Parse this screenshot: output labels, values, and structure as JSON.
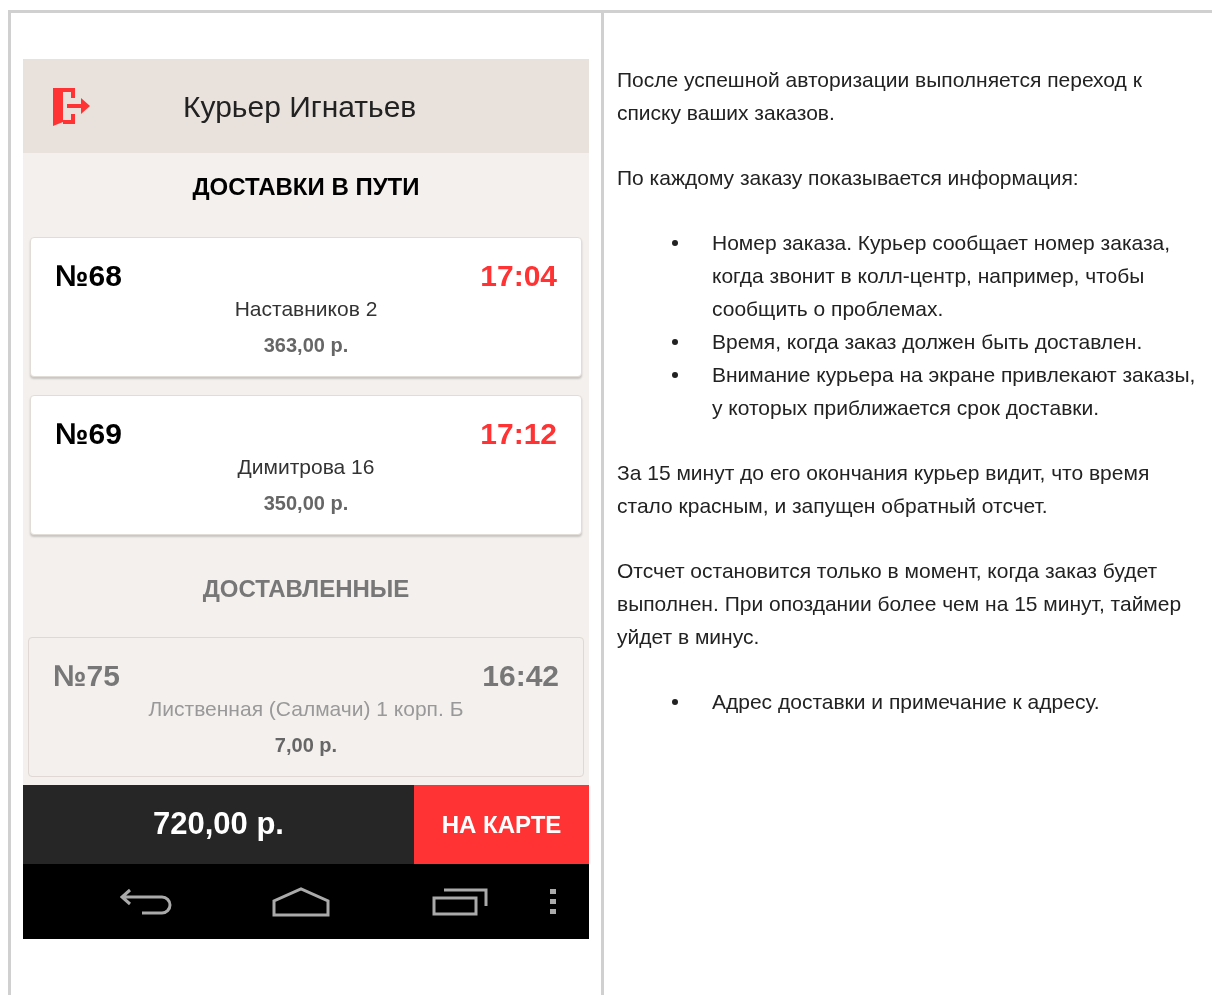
{
  "phone": {
    "header": {
      "title": "Курьер Игнатьев"
    },
    "sections": [
      {
        "kind": "active",
        "title": "ДОСТАВКИ В ПУТИ",
        "orders": [
          {
            "number": "№68",
            "time": "17:04",
            "urgent": true,
            "address": "Наставников 2",
            "price": "363,00 р."
          },
          {
            "number": "№69",
            "time": "17:12",
            "urgent": true,
            "address": "Димитрова 16",
            "price": "350,00 р."
          }
        ]
      },
      {
        "kind": "delivered",
        "title": "ДОСТАВЛЕННЫЕ",
        "orders": [
          {
            "number": "№75",
            "time": "16:42",
            "urgent": false,
            "address": "Лиственная (Салмачи) 1 корп. Б",
            "price": "7,00 р."
          }
        ]
      }
    ],
    "bottom_bar": {
      "total": "720,00 р.",
      "map_button": "НА КАРТЕ"
    }
  },
  "description": [
    {
      "kind": "paragraph",
      "text": "После успешной авторизации выполняется переход к списку ваших заказов."
    },
    {
      "kind": "paragraph",
      "text": "По каждому заказу показывается информация:"
    },
    {
      "kind": "list",
      "items": [
        "Номер заказа. Курьер сообщает номер заказа, когда звонит в колл-центр, например, чтобы сообщить о проблемах.",
        "Время, когда заказ должен быть доставлен.",
        "Внимание курьера на экране привлекают заказы, у которых приближается срок доставки."
      ]
    },
    {
      "kind": "paragraph",
      "text": "За 15 минут до его окончания курьер видит, что время стало красным, и запущен обратный отсчет."
    },
    {
      "kind": "paragraph",
      "text": "Отсчет остановится только в момент, когда заказ будет выполнен. При опоздании более чем на 15 минут, таймер уйдет в минус."
    },
    {
      "kind": "list",
      "items": [
        "Адрес доставки и примечание к адресу."
      ]
    }
  ]
}
